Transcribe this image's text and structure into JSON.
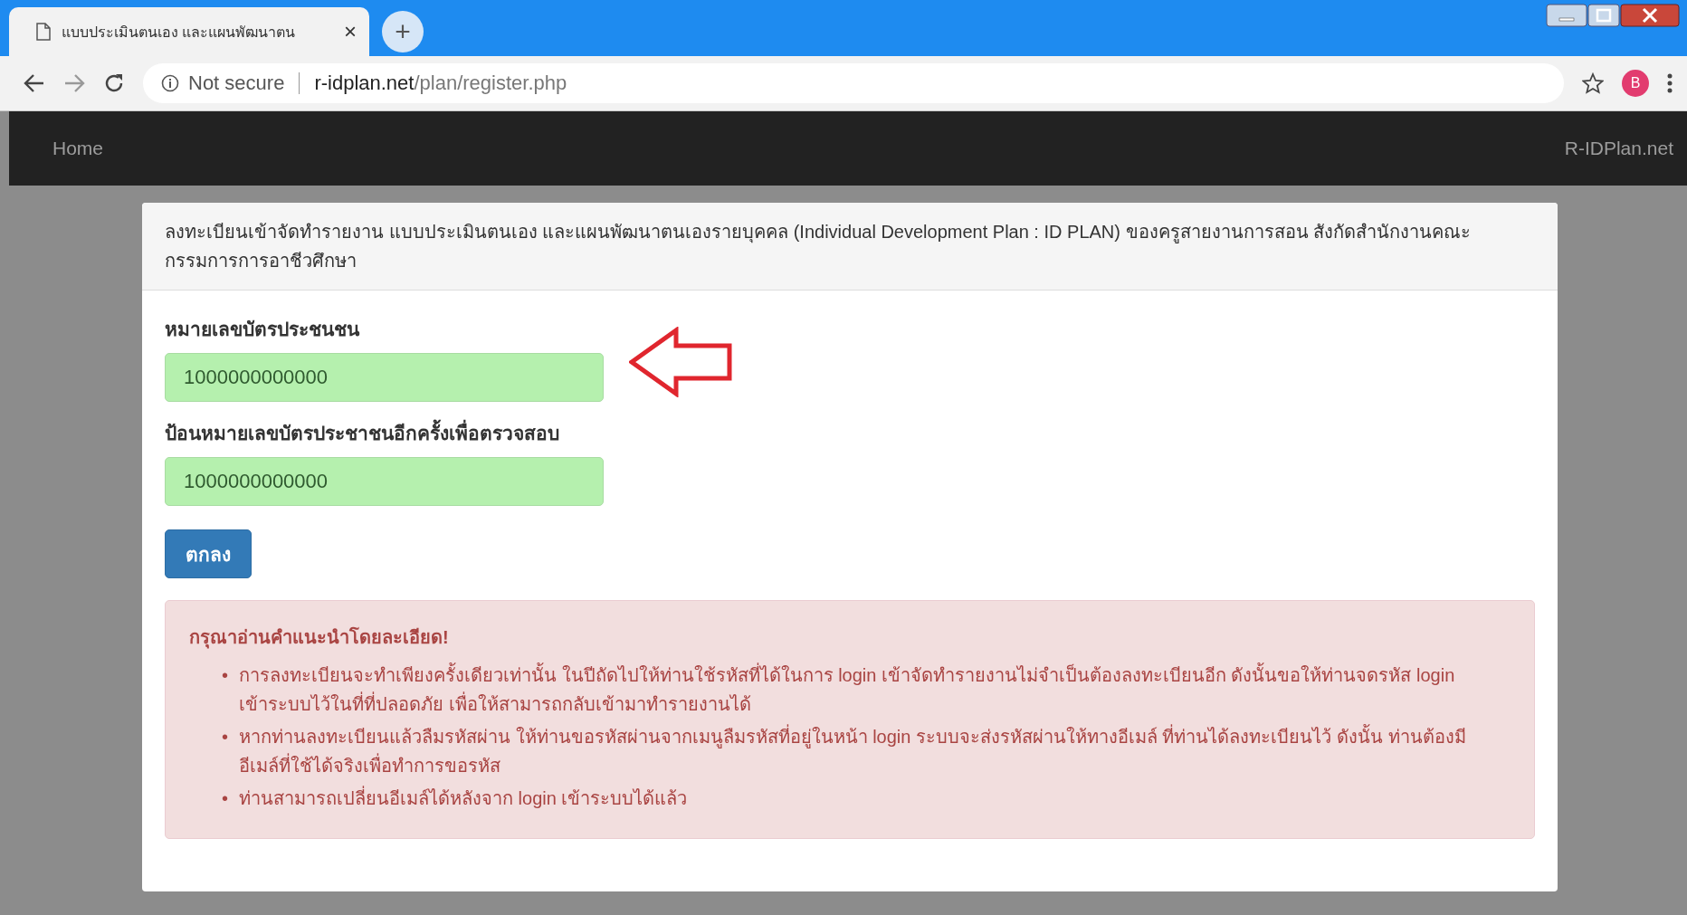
{
  "browser": {
    "tab_title": "แบบประเมินตนเอง และแผนพัฒนาตน",
    "tab_close": "×",
    "new_tab": "+",
    "security": "Not secure",
    "url_host": "r-idplan.net",
    "url_path": "/plan/register.php",
    "profile": "B"
  },
  "navbar": {
    "home": "Home",
    "brand": "R-IDPlan.net"
  },
  "card": {
    "heading": "ลงทะเบียนเข้าจัดทำรายงาน แบบประเมินตนเอง และแผนพัฒนาตนเองรายบุคคล (Individual Development Plan : ID PLAN) ของครูสายงานการสอน สังกัดสำนักงานคณะกรรมการการอาชีวศึกษา",
    "fields": [
      {
        "label": "หมายเลขบัตรประชนชน",
        "value": "1000000000000",
        "valid": true
      },
      {
        "label": "ป้อนหมายเลขบัตรประชาชนอีกครั้งเพื่อตรวจสอบ",
        "value": "1000000000000",
        "valid": true
      }
    ],
    "submit": "ตกลง",
    "alert": {
      "title": "กรุณาอ่านคำแนะนำโดยละเอียด!",
      "bullet": "•",
      "items": [
        "การลงทะเบียนจะทำเพียงครั้งเดียวเท่านั้น ในปีถัดไปให้ท่านใช้รหัสที่ได้ในการ login เข้าจัดทำรายงานไม่จำเป็นต้องลงทะเบียนอีก ดังนั้นขอให้ท่านจดรหัส login เข้าระบบไว้ในที่ที่ปลอดภัย เพื่อให้สามารถกลับเข้ามาทำรายงานได้",
        "หากท่านลงทะเบียนแล้วลืมรหัสผ่าน ให้ท่านขอรหัสผ่านจากเมนูลืมรหัสที่อยู่ในหน้า login ระบบจะส่งรหัสผ่านให้ทางอีเมล์ ที่ท่านได้ลงทะเบียนไว้ ดังนั้น ท่านต้องมีอีเมล์ที่ใช้ได้จริงเพื่อทำการขอรหัส",
        "ท่านสามารถเปลี่ยนอีเมล์ได้หลังจาก login เข้าระบบได้แล้ว"
      ]
    }
  }
}
